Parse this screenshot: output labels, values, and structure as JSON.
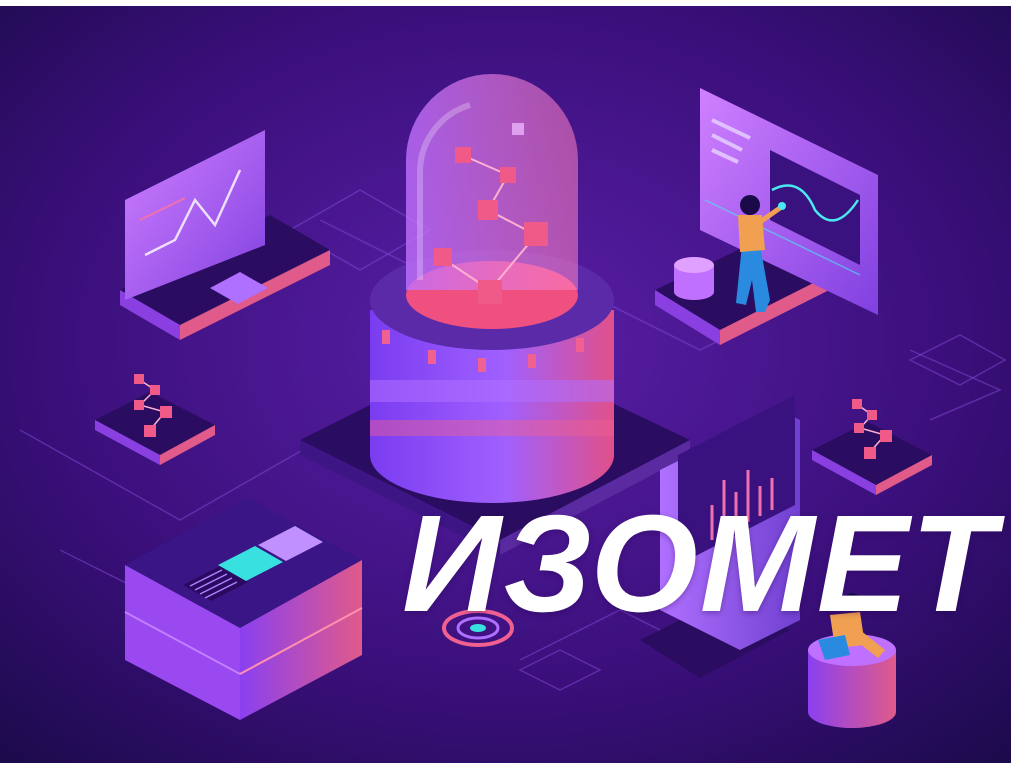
{
  "headline": "ИЗОМЕТ",
  "colors": {
    "background": "#3a0f7a",
    "background_deep": "#1b0a4a",
    "accent_pink": "#f0507a",
    "accent_violet": "#9b5cff",
    "accent_magenta": "#d070f0",
    "accent_cyan": "#38e0e0",
    "headline": "#ffffff"
  },
  "illustration": {
    "items": [
      "data-server-cylinder-icon",
      "glass-dome-icon",
      "node-network-icon",
      "laptop-icon",
      "wave-chart-screen-icon",
      "woman-touching-screen-icon",
      "bar-chart-kiosk-icon",
      "microchip-block-icon",
      "man-sitting-on-cylinder-icon",
      "small-network-platform-icon",
      "target-ring-icon"
    ]
  }
}
